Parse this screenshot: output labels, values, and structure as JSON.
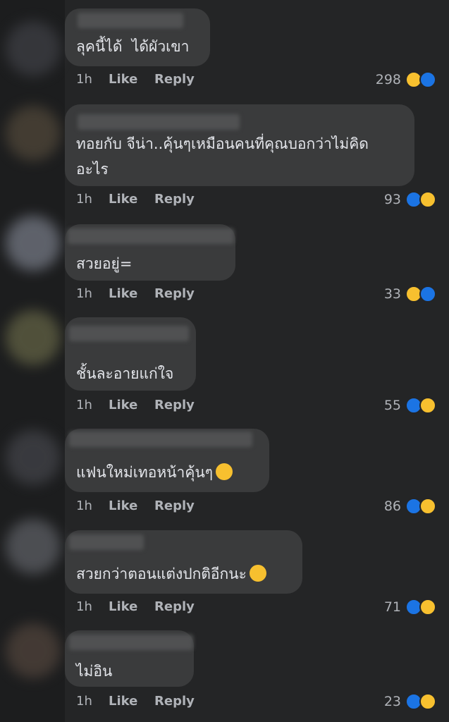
{
  "colors": {
    "bubble": "#3a3b3c",
    "background": "#242526",
    "like_blue": "#1b74e4",
    "haha_yellow": "#f7c02f",
    "text": "#e4e6eb",
    "meta_text": "#b0b3b8"
  },
  "comments": [
    {
      "text": "ลุคนี้ได้  ได้ผัวเขา",
      "time": "1h",
      "like": "Like",
      "reply": "Reply",
      "count": "298",
      "reactions": [
        "haha-icon",
        "like-icon"
      ],
      "avatar_color": "#3a3b40"
    },
    {
      "text": "ทอยกับ จีน่า..คุ้นๆเหมือนคนที่คุณบอกว่าไม่คิด\nอะไร",
      "time": "1h",
      "like": "Like",
      "reply": "Reply",
      "count": "93",
      "reactions": [
        "like-icon",
        "haha-icon"
      ],
      "avatar_color": "#4a4236"
    },
    {
      "text": "สวยอยู่=",
      "time": "1h",
      "like": "Like",
      "reply": "Reply",
      "count": "33",
      "reactions": [
        "haha-icon",
        "like-icon"
      ],
      "avatar_color": "#6a6e78"
    },
    {
      "text": "ชั้นละอายแก่ใจ",
      "time": "1h",
      "like": "Like",
      "reply": "Reply",
      "count": "55",
      "reactions": [
        "like-icon",
        "haha-icon"
      ],
      "avatar_color": "#5a5a40"
    },
    {
      "text": "แฟนใหม่เทอหน้าคุ้นๆ",
      "emoji": "rofl-emoji-icon",
      "time": "1h",
      "like": "Like",
      "reply": "Reply",
      "count": "86",
      "reactions": [
        "like-icon",
        "haha-icon"
      ],
      "avatar_color": "#3e3f44"
    },
    {
      "text": "สวยกว่าตอนแต่งปกติอีกนะ",
      "emoji": "rofl-emoji-icon",
      "time": "1h",
      "like": "Like",
      "reply": "Reply",
      "count": "71",
      "reactions": [
        "like-icon",
        "haha-icon"
      ],
      "avatar_color": "#55575c"
    },
    {
      "text": "ไม่อิน",
      "time": "1h",
      "like": "Like",
      "reply": "Reply",
      "count": "23",
      "reactions": [
        "like-icon",
        "haha-icon"
      ],
      "avatar_color": "#4a3f38"
    }
  ]
}
